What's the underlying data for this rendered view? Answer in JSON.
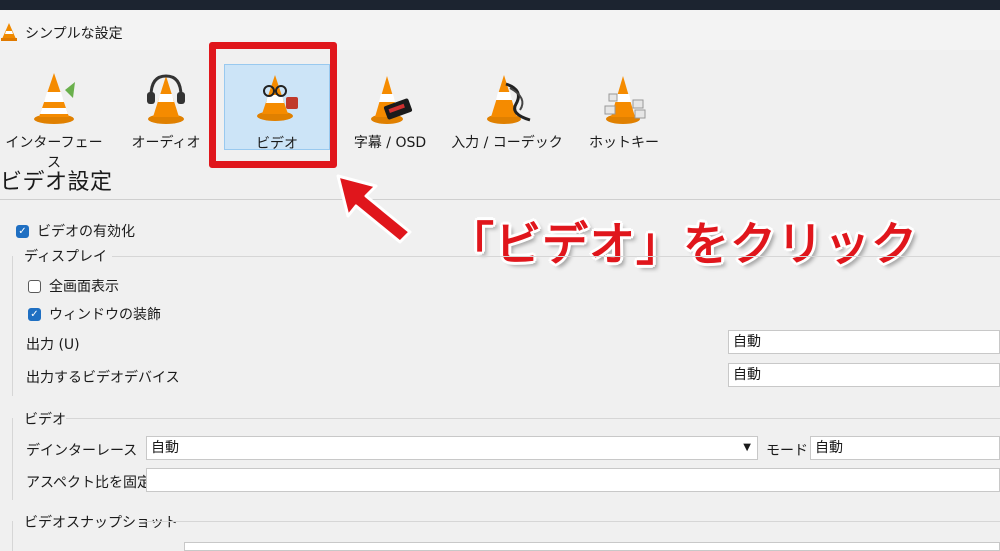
{
  "window": {
    "title": "シンプルな設定"
  },
  "categories": [
    {
      "label": "インターフェース",
      "icon": "vlc-cone-icon"
    },
    {
      "label": "オーディオ",
      "icon": "headphones-cone-icon"
    },
    {
      "label": "ビデオ",
      "icon": "glasses-cone-icon"
    },
    {
      "label": "字幕 / OSD",
      "icon": "subtitle-cone-icon"
    },
    {
      "label": "入力 / コーデック",
      "icon": "cable-cone-icon"
    },
    {
      "label": "ホットキー",
      "icon": "keyboard-cone-icon"
    }
  ],
  "section": {
    "title": "ビデオ設定"
  },
  "annotation": {
    "text": "「ビデオ」をクリック",
    "color": "#e0161c"
  },
  "video_enable": {
    "label": "ビデオの有効化",
    "checked": true
  },
  "display": {
    "label": "ディスプレイ",
    "fullscreen": {
      "label": "全画面表示",
      "checked": false
    },
    "window_deco": {
      "label": "ウィンドウの装飾",
      "checked": true
    },
    "output": {
      "label": "出力 (U)",
      "value": "自動"
    },
    "output_device": {
      "label": "出力するビデオデバイス",
      "value": "自動"
    }
  },
  "video": {
    "label": "ビデオ",
    "deinterlace": {
      "label": "デインターレース",
      "value": "自動"
    },
    "mode": {
      "label": "モード",
      "value": "自動"
    },
    "aspect": {
      "label": "アスペクト比を固定",
      "value": ""
    }
  },
  "snapshot": {
    "label": "ビデオスナップショット"
  }
}
